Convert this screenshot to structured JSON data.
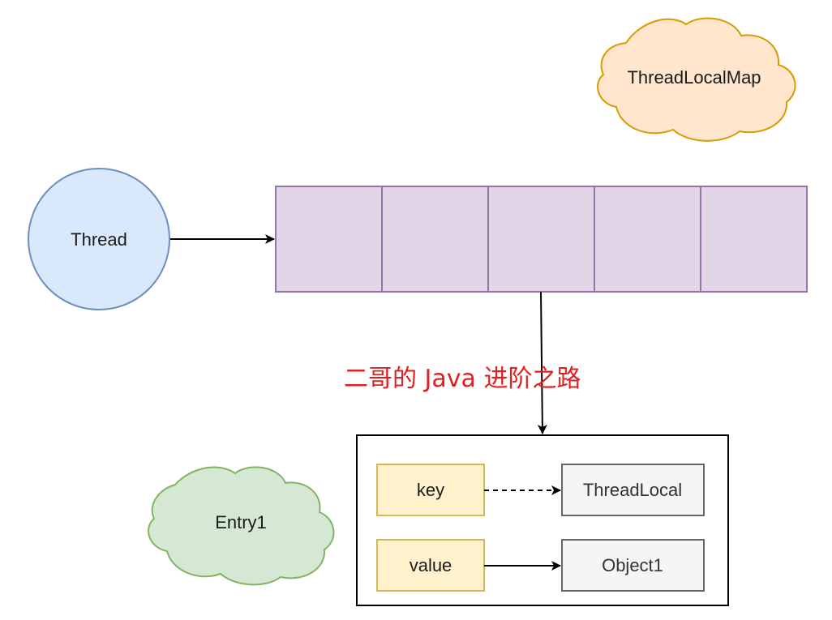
{
  "thread": {
    "label": "Thread"
  },
  "map_cloud": {
    "label": "ThreadLocalMap"
  },
  "entry_cloud": {
    "label": "Entry1"
  },
  "map_array": {
    "slot_count": 5
  },
  "entry": {
    "key_label": "key",
    "value_label": "value",
    "key_target": "ThreadLocal",
    "value_target": "Object1"
  },
  "watermark": {
    "text": "二哥的 Java 进阶之路"
  },
  "colors": {
    "thread_fill": "#dae8fc",
    "thread_stroke": "#6c8ebf",
    "array_fill": "#e1d5e7",
    "array_stroke": "#9673a6",
    "map_cloud_fill": "#ffe6cc",
    "map_cloud_stroke": "#d79b00",
    "entry_cloud_fill": "#d5e8d4",
    "entry_cloud_stroke": "#82b366",
    "field_fill": "#fff2cc",
    "field_stroke": "#d6b656",
    "target_fill": "#f5f5f5",
    "target_stroke": "#666666",
    "watermark": "#e02020"
  }
}
